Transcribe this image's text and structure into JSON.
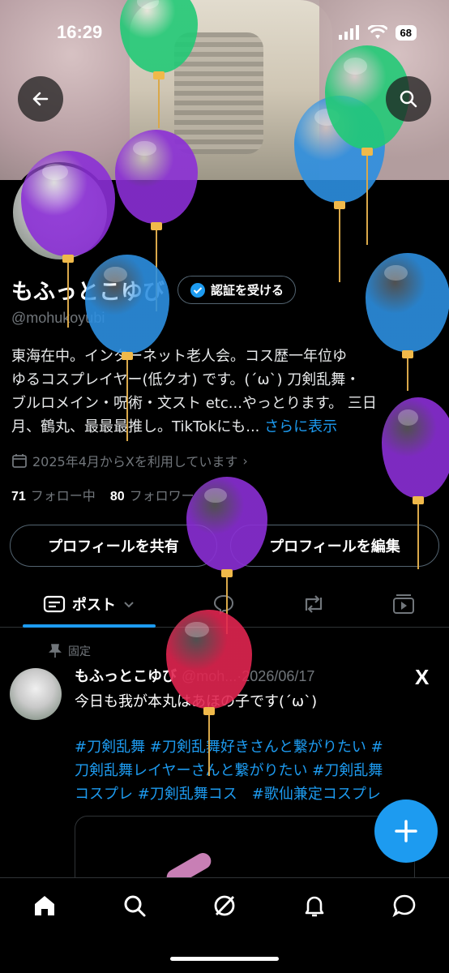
{
  "status": {
    "time": "16:29",
    "battery": "68"
  },
  "profile": {
    "display_name": "もふっとこゆび",
    "verify_label": "認証を受ける",
    "handle": "@mohukoyubi",
    "bio_lines": [
      "東海在中。インターネット老人会。コス歴一年位ゆ",
      "ゆるコスプレイヤー(低クオ) です。(´ω`) 刀剣乱舞・",
      "ブルロメイン・呪術・文スト etc...やっとります。 三日",
      "月、鶴丸、最最最推し。TikTokにも..."
    ],
    "bio_more": "さらに表示",
    "joined": "2025年4月からXを利用しています",
    "following_count": "71",
    "following_label": "フォロー中",
    "followers_count": "80",
    "followers_label": "フォロワー",
    "share_label": "プロフィールを共有",
    "edit_label": "プロフィールを編集"
  },
  "tabs": {
    "posts_label": "ポスト"
  },
  "post": {
    "pinned_label": "固定",
    "name": "もふっとこゆび",
    "meta": "@moh...·2026/06/17",
    "text": "今日も我が本丸はあほの子です(´ω`)",
    "hashtag_lines": [
      "#刀剣乱舞  #刀剣乱舞好きさんと繋がりたい  #",
      "刀剣乱舞レイヤーさんと繋がりたい  #刀剣乱舞",
      "コスプレ #刀剣乱舞コス　#歌仙兼定コスプレ"
    ]
  },
  "colors": {
    "accent": "#1d9bf0",
    "background": "#000000"
  },
  "icons": {
    "back": "arrow-left-icon",
    "search": "search-icon",
    "verified": "verified-badge-icon",
    "calendar": "calendar-icon",
    "pin": "pin-icon",
    "x_logo": "x-logo-icon",
    "compose": "plus-icon",
    "nav": [
      "home-icon",
      "search-icon",
      "grok-icon",
      "bell-icon",
      "message-icon"
    ]
  },
  "overlay": {
    "balloon_colors": [
      "#22c976",
      "#8b2fd6",
      "#8b2fd6",
      "#2d8fe0",
      "#2d8fe0",
      "#22c976",
      "#2d8fe0",
      "#8b2fd6",
      "#8b2fd6",
      "#e02550"
    ]
  }
}
